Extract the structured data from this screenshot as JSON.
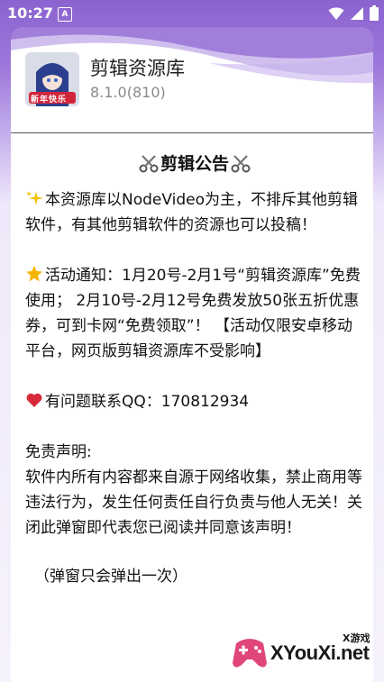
{
  "status_bar": {
    "time": "10:27",
    "notification_icon_letter": "A"
  },
  "dialog": {
    "app_name": "剪辑资源库",
    "app_version": "8.1.0(810)",
    "notice_title": "剪辑公告",
    "paragraphs": [
      "本资源库以NodeVideo为主，不排斥其他剪辑软件，有其他剪辑软件的资源也可以投稿！",
      "活动通知：1月20号-2月1号“剪辑资源库”免费使用； 2月10号-2月12号免费发放50张五折优惠券，可到卡网“免费领取”！ 【活动仅限安卓移动平台，网页版剪辑资源库不受影响】",
      "有问题联系QQ：170812934"
    ],
    "disclaimer_title": "免责声明:",
    "disclaimer_body": "软件内所有内容都来自源于网络收集，禁止商用等违法行为，发生任何责任自行负责与他人无关！关闭此弹窗即代表您已阅读并同意该声明！",
    "footnote": "（弹窗只会弹出一次）",
    "icon_label": "新年快乐"
  },
  "watermark": {
    "text": "XYouXi.net",
    "sub": "X游戏"
  },
  "colors": {
    "accent": "#8b63cf",
    "heart": "#d62b3a",
    "star": "#f5b400",
    "sparkle": "#f2c200"
  },
  "icons": [
    "scissors-icon",
    "sparkle-icon",
    "star-icon",
    "heart-icon",
    "wifi-icon",
    "signal-icon",
    "battery-icon"
  ]
}
